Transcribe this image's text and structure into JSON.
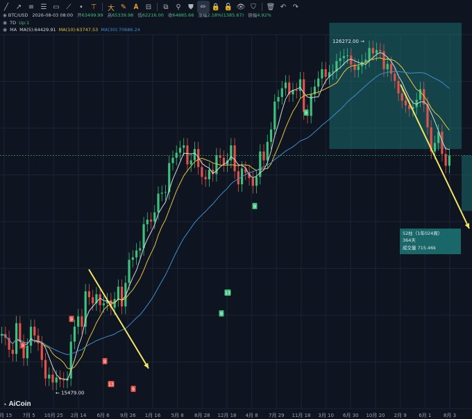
{
  "toolbar": {
    "icons": [
      "line-tool-icon",
      "ray-tool-icon",
      "parallel-tool-icon",
      "fib-tool-icon",
      "rect-tool-icon",
      "brush-tool-icon",
      "dot-tool-icon",
      "long-tool-icon",
      "short-tool-icon",
      "measure-tool-icon",
      "text-tool-icon",
      "price-range-icon",
      "copy-icon",
      "link-icon",
      "magnet-icon",
      "pencil-icon",
      "lock-icon",
      "unlock-icon",
      "eye-icon",
      "filter-icon",
      "trash-icon",
      "undo-icon",
      "redo-icon"
    ]
  },
  "ohlc": {
    "pair": "BTC/USD",
    "time": "2026-08-03 08:00",
    "open_label": "开",
    "open": "63499.99",
    "high_label": "高",
    "high": "65339.98",
    "low_label": "低",
    "low": "62216.00",
    "close_label": "收",
    "close": "64885.66",
    "change_label": "涨幅",
    "change": "2.18%(1385.67)",
    "amp_label": "振幅",
    "amp": "4.92%"
  },
  "td": {
    "name": "TD",
    "value": "Up:1"
  },
  "ma": {
    "name": "MA",
    "ma5": "MA(5):64429.91",
    "ma10": "MA(10):63747.53",
    "ma30": "MA(30):70686.24"
  },
  "colors": {
    "bg": "#0e1420",
    "up": "#3ec17c",
    "down": "#e0534a",
    "ma5": "#d9d9d9",
    "ma10": "#e5c542",
    "ma30": "#3d8fcf",
    "arrow": "#f5e663",
    "box": "#1a6b6e",
    "grid": "#1c2433"
  },
  "logo": {
    "text": "AiCoin"
  },
  "chart_data": {
    "type": "candlestick",
    "xticks": [
      "8月 15",
      "7月 5",
      "10月 25",
      "2月 14",
      "6月 6",
      "9月 26",
      "1月 16",
      "5月 8",
      "8月 28",
      "12月 18",
      "4月 8",
      "7月 29",
      "11月 18",
      "3月 10",
      "6月 30",
      "10月 20",
      "2月 9",
      "6月 1",
      "8月 3"
    ],
    "annotations": {
      "high_label": "126272.00",
      "low_label": "15479.00",
      "td_labels": [
        {
          "text": "9",
          "kind": "down",
          "x_index": 1
        },
        {
          "text": "9",
          "kind": "down",
          "x_index": 2
        },
        {
          "text": "9",
          "kind": "down",
          "x_index": 4
        },
        {
          "text": "13",
          "kind": "down",
          "x_index": 4
        },
        {
          "text": "9",
          "kind": "down",
          "x_index": 5
        },
        {
          "text": "13",
          "kind": "up",
          "x_index": 9
        },
        {
          "text": "9",
          "kind": "up",
          "x_index": 9
        },
        {
          "text": "9",
          "kind": "up",
          "x_index": 10
        },
        {
          "text": "9",
          "kind": "up",
          "x_index": 12
        }
      ],
      "range_box": {
        "bars": "52柱（1年024周）",
        "days": "364天",
        "volume": "成交量  715.46k"
      }
    },
    "close_series": [
      22000,
      21500,
      20000,
      19500,
      23500,
      21000,
      19000,
      20500,
      23000,
      21800,
      20800,
      18800,
      16800,
      17200,
      16400,
      16900,
      16700,
      16600,
      16800,
      21000,
      23000,
      24500,
      23000,
      28500,
      27500,
      26500,
      28000,
      26200,
      26500,
      27000,
      25800,
      27200,
      29300,
      26000,
      30000,
      34500,
      35000,
      36500,
      37000,
      42800,
      44000,
      43500,
      46000,
      51500,
      51800,
      52000,
      62000,
      64000,
      66000,
      68000,
      69000,
      61500,
      63000,
      67500,
      60500,
      57000,
      56200,
      59500,
      58000,
      65000,
      64000,
      61500,
      63000,
      69000,
      59000,
      54500,
      60000,
      58500,
      56600,
      54000,
      57000,
      66500,
      63000,
      70500,
      76000,
      90000,
      92500,
      97500,
      101000,
      94000,
      96500,
      96000,
      103000,
      84500,
      82500,
      94000,
      98500,
      103500,
      109500,
      104500,
      107500,
      108000,
      115000,
      117000,
      118500,
      119000,
      112500,
      109000,
      111500,
      114500,
      116000,
      124500,
      120500,
      123000,
      122000,
      109500,
      113000,
      106500,
      102000,
      94500,
      90500,
      88000,
      86000,
      87000,
      91000,
      97000,
      88500,
      77000,
      66500,
      70000,
      75000,
      65500,
      61000,
      64900
    ],
    "ylim": [
      14000,
      135000
    ],
    "overlay_ma": [
      "MA(5)",
      "MA(10)",
      "MA(30)"
    ]
  }
}
